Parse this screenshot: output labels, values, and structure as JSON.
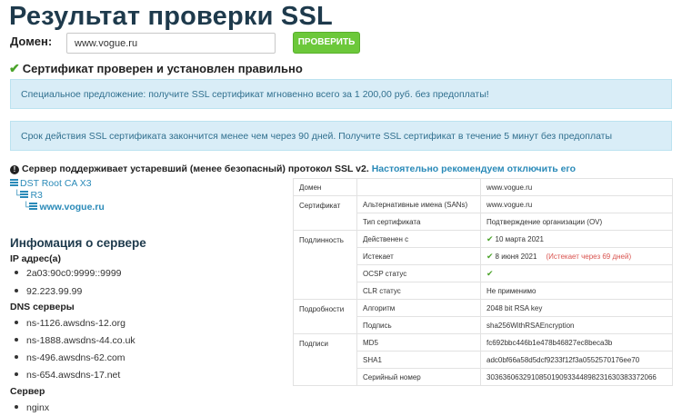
{
  "title": "Результат проверки SSL",
  "form": {
    "domain_label": "Домен:",
    "domain_value": "www.vogue.ru",
    "check_button": "ПРОВЕРИТЬ"
  },
  "status": {
    "icon": "check-icon",
    "text": "Сертификат проверен и установлен правильно"
  },
  "offers": [
    "Специальное предложение: получите SSL сертификат мгновенно всего за 1 200,00 руб. без предоплаты!",
    "Срок действия SSL сертификата закончится менее чем через 90 дней. Получите SSL сертификат в течение 5 минут без предоплаты"
  ],
  "warning": {
    "icon": "exclamation-icon",
    "text": "Сервер поддерживает устаревший (менее безопасный) протокол SSL v2.",
    "link": "Настоятельно рекомендуем отключить его"
  },
  "chain": [
    "DST Root CA X3",
    "R3",
    "www.vogue.ru"
  ],
  "server_info": {
    "title": "Инфомация о сервере",
    "ip_label": "IP адрес(а)",
    "ips": [
      "2a03:90c0:9999::9999",
      "92.223.99.99"
    ],
    "dns_label": "DNS серверы",
    "dns": [
      "ns-1126.awsdns-12.org",
      "ns-1888.awsdns-44.co.uk",
      "ns-496.awsdns-62.com",
      "ns-654.awsdns-17.net"
    ],
    "server_label": "Сервер",
    "server": [
      "nginx"
    ]
  },
  "table": {
    "domain": {
      "label": "Домен",
      "value": "www.vogue.ru"
    },
    "certificate": {
      "label": "Сертификат",
      "rows": [
        {
          "k": "Альтернативные имена (SANs)",
          "v": "www.vogue.ru"
        },
        {
          "k": "Тип сертификата",
          "v": "Подтверждение организации (OV)"
        }
      ]
    },
    "validity": {
      "label": "Подлинность",
      "valid_from_label": "Действенен с",
      "valid_from": "10 марта 2021",
      "expires_label": "Истекает",
      "expires": "8 июня 2021",
      "expires_note": "(Истекает через 69 дней)",
      "ocsp_label": "OCSP статус",
      "crl_label": "CLR статус",
      "crl": "Не применимо"
    },
    "details": {
      "label": "Подробности",
      "rows": [
        {
          "k": "Алгоритм",
          "v": "2048 bit RSA key"
        },
        {
          "k": "Подпись",
          "v": "sha256WithRSAEncryption"
        }
      ]
    },
    "signatures": {
      "label": "Подписи",
      "rows": [
        {
          "k": "MD5",
          "v": "fc692bbc446b1e478b46827ec8beca3b"
        },
        {
          "k": "SHA1",
          "v": "adc0bf66a58d5dcf9233f12f3a0552570176ee70"
        },
        {
          "k": "Серийный номер",
          "v": "303636063291085019093344898231630383372066"
        }
      ]
    }
  },
  "colors": {
    "accent": "#2a8ab8",
    "title": "#1e3a4c",
    "button": "#6cc83a",
    "info_bg": "#d9edf7",
    "ok": "#4aa329",
    "danger": "#d9534f"
  }
}
